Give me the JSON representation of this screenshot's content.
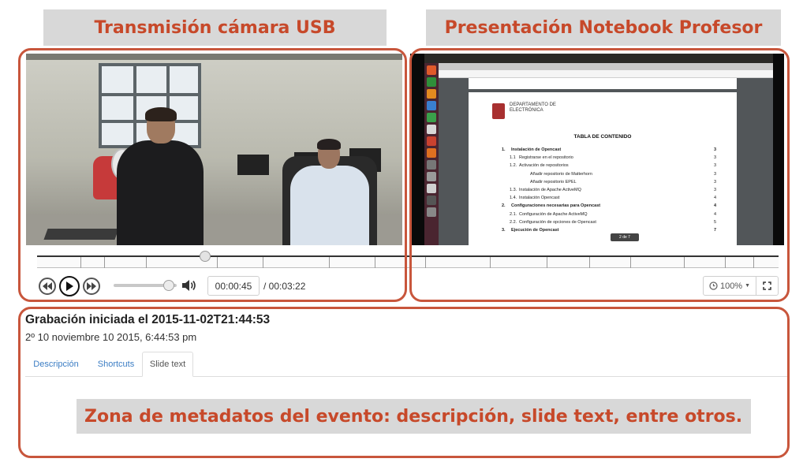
{
  "annotations": {
    "camera": "Transmisión cámara USB",
    "presentation": "Presentación Notebook Profesor",
    "metadata": "Zona de metadatos del evento: descripción, slide text, entre otros."
  },
  "presentation_slide": {
    "department_lines": [
      "DEPARTAMENTO DE",
      "ELECTRÓNICA"
    ],
    "title": "TABLA DE CONTENIDO",
    "toc": [
      {
        "num": "1.",
        "text": "Instalación de Opencast",
        "page": "3",
        "bold": true,
        "indent": 0
      },
      {
        "num": "1.1",
        "text": "Registrarse en el repositorio",
        "page": "3",
        "bold": false,
        "indent": 1
      },
      {
        "num": "1.2.",
        "text": "Activación de repositorios",
        "page": "3",
        "bold": false,
        "indent": 1
      },
      {
        "num": "",
        "text": "Añadir repositorio de Matterhorn",
        "page": "3",
        "bold": false,
        "indent": 2
      },
      {
        "num": "",
        "text": "Añadir repositorio EPEL",
        "page": "3",
        "bold": false,
        "indent": 2
      },
      {
        "num": "1.3.",
        "text": "Instalación de Apache ActiveMQ",
        "page": "3",
        "bold": false,
        "indent": 1
      },
      {
        "num": "1.4.",
        "text": "Instalación Opencast",
        "page": "4",
        "bold": false,
        "indent": 1
      },
      {
        "num": "2.",
        "text": "Configuraciones necesarias para Opencast",
        "page": "4",
        "bold": true,
        "indent": 0
      },
      {
        "num": "2.1.",
        "text": "Configuración de Apache ActiveMQ",
        "page": "4",
        "bold": false,
        "indent": 1
      },
      {
        "num": "2.2.",
        "text": "Configuración de opciones de Opencast",
        "page": "5",
        "bold": false,
        "indent": 1
      },
      {
        "num": "3.",
        "text": "Ejecución de Opencast",
        "page": "7",
        "bold": true,
        "indent": 0
      }
    ],
    "page_indicator": "2 de 7"
  },
  "player": {
    "current_time": "00:00:45",
    "total_time": "/ 00:03:22",
    "zoom": "100%",
    "progress_fraction": 0.227,
    "volume_fraction": 0.87
  },
  "event": {
    "title": "Grabación iniciada el 2015-11-02T21:44:53",
    "date": "2º 10 noviembre 10 2015, 6:44:53 pm"
  },
  "tabs": [
    "Descripción",
    "Shortcuts",
    "Slide text"
  ],
  "active_tab": "Slide text",
  "icons": {
    "rewind": "rewind-icon",
    "play": "play-icon",
    "forward": "fast-forward-icon",
    "volume": "speaker-icon",
    "zoom": "clock-icon",
    "fullscreen": "expand-icon"
  },
  "colors": {
    "annotation_text": "#c7492a",
    "annotation_frame": "#c8563c",
    "tab_link": "#3b7dc4"
  }
}
